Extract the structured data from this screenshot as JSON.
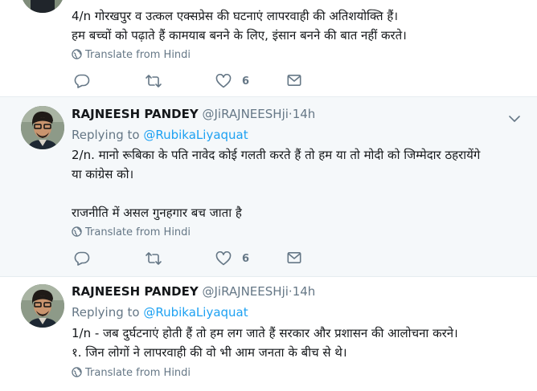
{
  "tweets": [
    {
      "lines": [
        "4/n गोरखपुर व उत्कल एक्सप्रेस की घटनाएं लापरवाही की अतिशयोक्ति हैं।",
        "हम बच्चों को पढ़ाते हैं कामयाब बनने के लिए, इंसान बनने की बात नहीं करते।"
      ],
      "translate": "Translate from Hindi",
      "likes": "6"
    },
    {
      "name": "RAJNEESH PANDEY",
      "handle": "@JiRAJNEESHji",
      "sep": "·",
      "time": "14h",
      "replying_prefix": "Replying to",
      "replying_to": "@RubikaLiyaquat",
      "lines": [
        "2/n. मानो रूबिका के पति नावेद कोई गलती करते हैं तो हम या तो मोदी को जिम्मेदार ठहरायेंगे",
        "या कांग्रेस को।",
        "",
        "राजनीति में असल गुनहगार बच जाता है"
      ],
      "translate": "Translate from Hindi",
      "likes": "6"
    },
    {
      "name": "RAJNEESH PANDEY",
      "handle": "@JiRAJNEESHji",
      "sep": "·",
      "time": "14h",
      "replying_prefix": "Replying to",
      "replying_to": "@RubikaLiyaquat",
      "lines": [
        "1/n - जब दुर्घटनाएं होती हैं तो हम लग जाते हैं सरकार और प्रशासन की आलोचना करने।",
        "१. जिन लोगों ने लापरवाही की वो भी आम जनता के बीच से थे।"
      ],
      "translate": "Translate from Hindi"
    }
  ],
  "colors": {
    "accent": "#1da1f2",
    "secondary_text": "#657786",
    "highlight_bg": "#f5f8fa",
    "divider": "#e6ecf0"
  },
  "icons": [
    "reply-icon",
    "retweet-icon",
    "like-icon",
    "message-icon",
    "globe-icon",
    "chevron-down-icon"
  ]
}
